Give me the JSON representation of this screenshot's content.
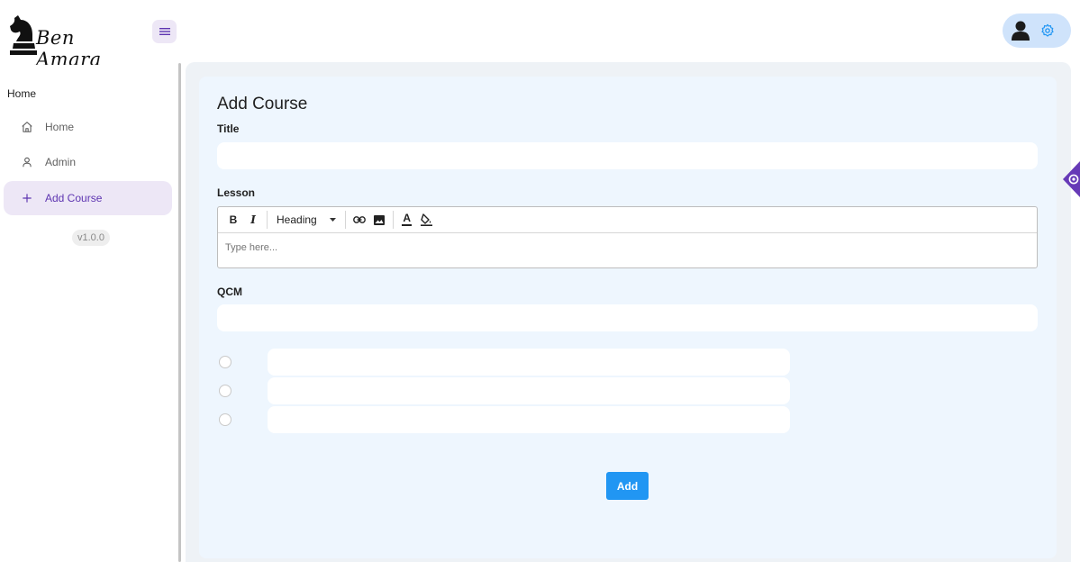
{
  "brand": {
    "name": "Ben Amara"
  },
  "sidebar": {
    "caption": "Home",
    "items": [
      {
        "label": "Home",
        "icon": "home-icon"
      },
      {
        "label": "Admin",
        "icon": "user-icon"
      },
      {
        "label": "Add Course",
        "icon": "plus-icon",
        "active": true
      }
    ],
    "version": "v1.0.0"
  },
  "form": {
    "title": "Add Course",
    "title_label": "Title",
    "title_value": "",
    "lesson_label": "Lesson",
    "editor": {
      "toolbar": {
        "bold": "B",
        "italic": "I",
        "heading": "Heading",
        "font_color": "A"
      },
      "placeholder": "Type here..."
    },
    "qcm_label": "QCM",
    "qcm_value": "",
    "options": [
      "",
      "",
      ""
    ],
    "submit_label": "Add"
  },
  "colors": {
    "accent": "#5e35b1",
    "primary": "#2196f3",
    "card_bg": "#eef6fe"
  }
}
